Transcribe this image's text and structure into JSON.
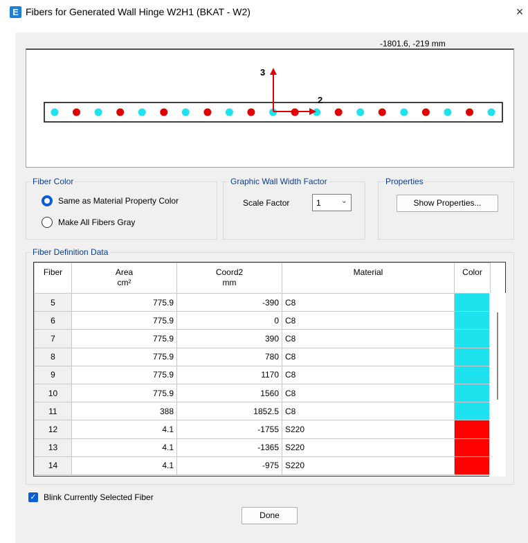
{
  "window": {
    "title": "Fibers for Generated Wall Hinge W2H1  (BKAT -  W2)",
    "app_icon_letter": "E",
    "close_glyph": "×"
  },
  "canvas": {
    "cursor_readout": "-1801.6, -219 mm",
    "axis_vertical_label": "3",
    "axis_horizontal_label": "2",
    "fiber_sequence": [
      "cyan",
      "red",
      "cyan",
      "red",
      "cyan",
      "red",
      "cyan",
      "red",
      "cyan",
      "red",
      "cyan",
      "red",
      "cyan",
      "red",
      "cyan",
      "red",
      "cyan",
      "red",
      "cyan",
      "red",
      "cyan"
    ],
    "colors": {
      "concrete": "#1ee3ef",
      "steel": "#e00000",
      "axis": "#e00000"
    }
  },
  "fiber_color": {
    "title": "Fiber Color",
    "option_material": "Same as Material Property Color",
    "option_gray": "Make All Fibers Gray",
    "selected": "material"
  },
  "wall_width": {
    "title": "Graphic Wall Width Factor",
    "scale_label": "Scale Factor",
    "scale_value": "1"
  },
  "properties": {
    "title": "Properties",
    "button_label": "Show Properties..."
  },
  "fiber_table": {
    "title": "Fiber Definition Data",
    "headers": {
      "fiber": "Fiber",
      "area": "Area",
      "area_unit": "cm²",
      "coord2": "Coord2",
      "coord2_unit": "mm",
      "material": "Material",
      "color": "Color"
    },
    "rows": [
      {
        "fiber": "5",
        "area": "775.9",
        "coord2": "-390",
        "material": "C8",
        "color": "#1ee3ef"
      },
      {
        "fiber": "6",
        "area": "775.9",
        "coord2": "0",
        "material": "C8",
        "color": "#1ee3ef"
      },
      {
        "fiber": "7",
        "area": "775.9",
        "coord2": "390",
        "material": "C8",
        "color": "#1ee3ef"
      },
      {
        "fiber": "8",
        "area": "775.9",
        "coord2": "780",
        "material": "C8",
        "color": "#1ee3ef"
      },
      {
        "fiber": "9",
        "area": "775.9",
        "coord2": "1170",
        "material": "C8",
        "color": "#1ee3ef"
      },
      {
        "fiber": "10",
        "area": "775.9",
        "coord2": "1560",
        "material": "C8",
        "color": "#1ee3ef"
      },
      {
        "fiber": "11",
        "area": "388",
        "coord2": "1852.5",
        "material": "C8",
        "color": "#1ee3ef"
      },
      {
        "fiber": "12",
        "area": "4.1",
        "coord2": "-1755",
        "material": "S220",
        "color": "#ff0000"
      },
      {
        "fiber": "13",
        "area": "4.1",
        "coord2": "-1365",
        "material": "S220",
        "color": "#ff0000"
      },
      {
        "fiber": "14",
        "area": "4.1",
        "coord2": "-975",
        "material": "S220",
        "color": "#ff0000"
      }
    ]
  },
  "blink": {
    "label": "Blink Currently Selected Fiber",
    "checked": true
  },
  "done_label": "Done"
}
